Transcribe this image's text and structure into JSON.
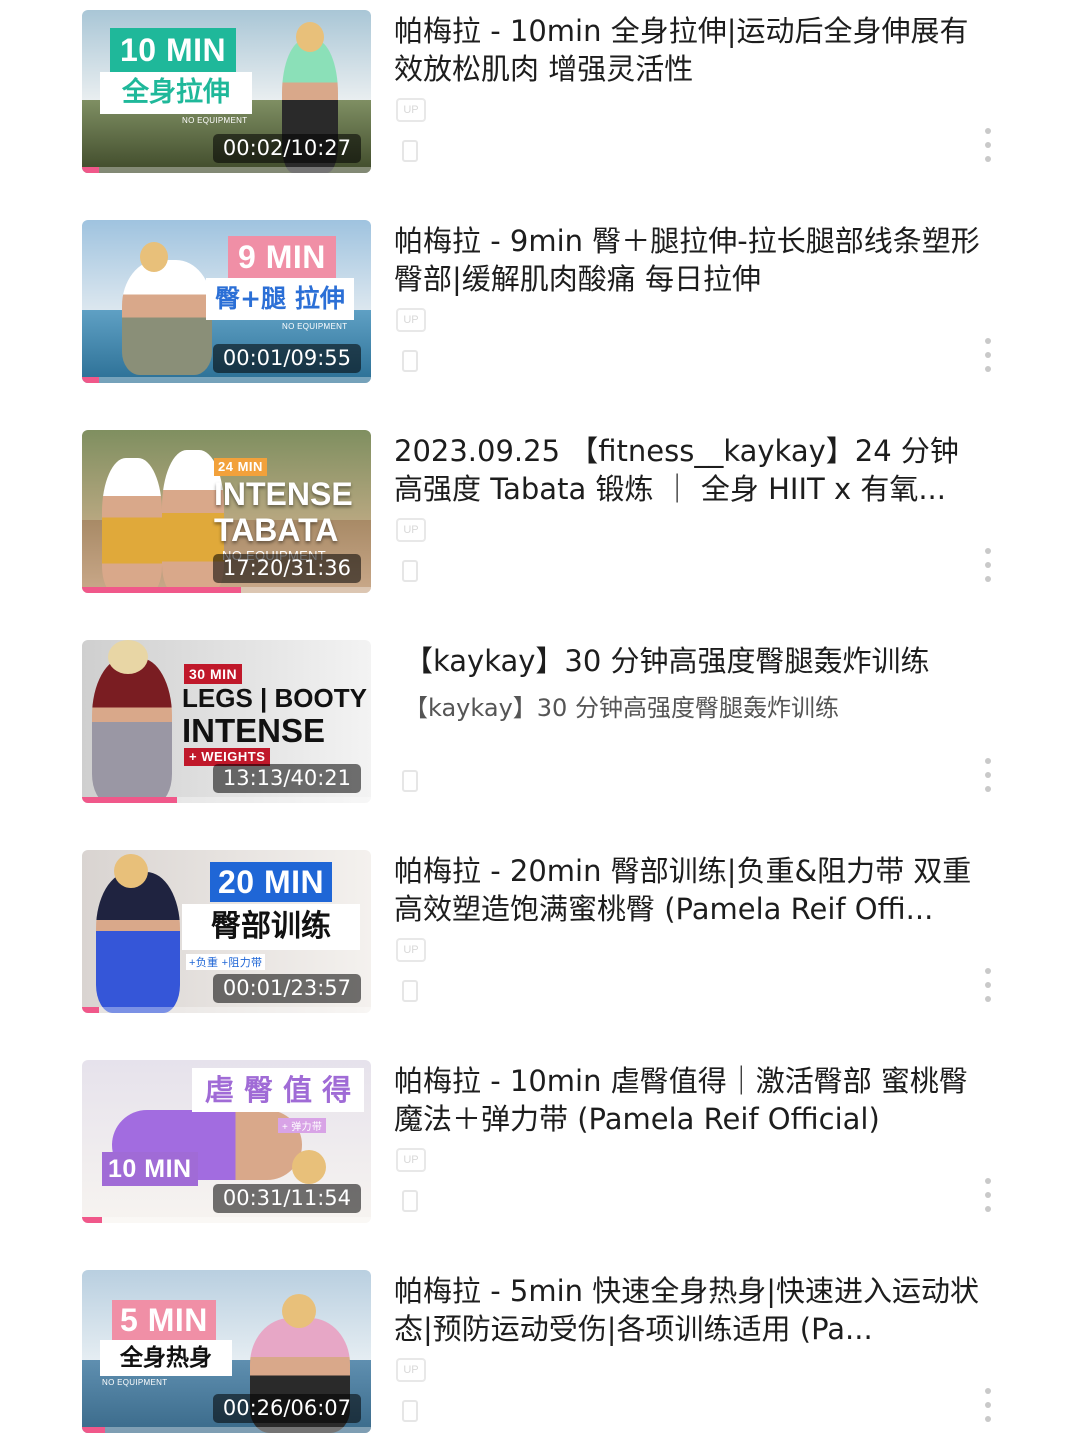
{
  "videos": [
    {
      "title": "帕梅拉 - 10min 全身拉伸|运动后全身伸展有效放松肌肉 增强灵活性",
      "subtitle": "",
      "duration": "00:02/10:27",
      "progress": 0.06,
      "thumb": {
        "badge": "10 MIN",
        "label": "全身拉伸",
        "note": "NO EQUIPMENT",
        "badge_color": "#1fb89a"
      }
    },
    {
      "title": "帕梅拉 - 9min 臀＋腿拉伸-拉长腿部线条塑形臀部|缓解肌肉酸痛 每日拉伸",
      "subtitle": "",
      "duration": "00:01/09:55",
      "progress": 0.06,
      "thumb": {
        "badge": "9 MIN",
        "label": "臀+腿 拉伸",
        "note": "NO EQUIPMENT",
        "badge_color": "#f08fa6"
      }
    },
    {
      "title": "2023.09.25 【fitness__kaykay】24 分钟 高强度 Tabata 锻炼 ｜ 全身 HIIT x 有氧...",
      "subtitle": "",
      "duration": "17:20/31:36",
      "progress": 0.55,
      "thumb": {
        "badge": "24 MIN",
        "line1": "INTENSE",
        "line2": "TABATA",
        "note": "NO EQUIPMENT",
        "badge_color": "#f2a13b"
      }
    },
    {
      "title": "【kaykay】30 分钟高强度臀腿轰炸训练",
      "subtitle": "【kaykay】30 分钟高强度臀腿轰炸训练",
      "duration": "13:13/40:21",
      "progress": 0.33,
      "thumb": {
        "badge": "30 MIN",
        "line1": "LEGS | BOOTY",
        "line2": "INTENSE",
        "note": "+ WEIGHTS",
        "badge_color": "#c0182a"
      }
    },
    {
      "title": "帕梅拉 - 20min 臀部训练|负重&阻力带 双重高效塑造饱满蜜桃臀 (Pamela Reif Offi...",
      "subtitle": "",
      "duration": "00:01/23:57",
      "progress": 0.06,
      "thumb": {
        "badge": "20 MIN",
        "label": "臀部训练",
        "note": "+负重 +阻力带",
        "badge_color": "#1f66d6"
      }
    },
    {
      "title": "帕梅拉 - 10min 虐臀值得｜激活臀部 蜜桃臀魔法＋弹力带 (Pamela Reif Official)",
      "subtitle": "",
      "duration": "00:31/11:54",
      "progress": 0.07,
      "thumb": {
        "badge": "10 MIN",
        "label": "虐 臀 值 得",
        "note": "+ 弹力带",
        "badge_color": "#a06bd6"
      }
    },
    {
      "title": "帕梅拉 - 5min 快速全身热身|快速进入运动状态|预防运动受伤|各项训练适用 (Pa...",
      "subtitle": "",
      "duration": "00:26/06:07",
      "progress": 0.08,
      "thumb": {
        "badge": "5 MIN",
        "label": "全身热身",
        "note": "NO EQUIPMENT",
        "badge_color": "#f08fa6"
      }
    }
  ],
  "colors": {
    "progress": "#f0588a",
    "menu_dots": "#c9c9c9"
  },
  "icons": {
    "more": "more-vertical-icon",
    "uploader": "up-icon",
    "plays": "play-count-icon"
  },
  "ghost_up_text": "UP"
}
